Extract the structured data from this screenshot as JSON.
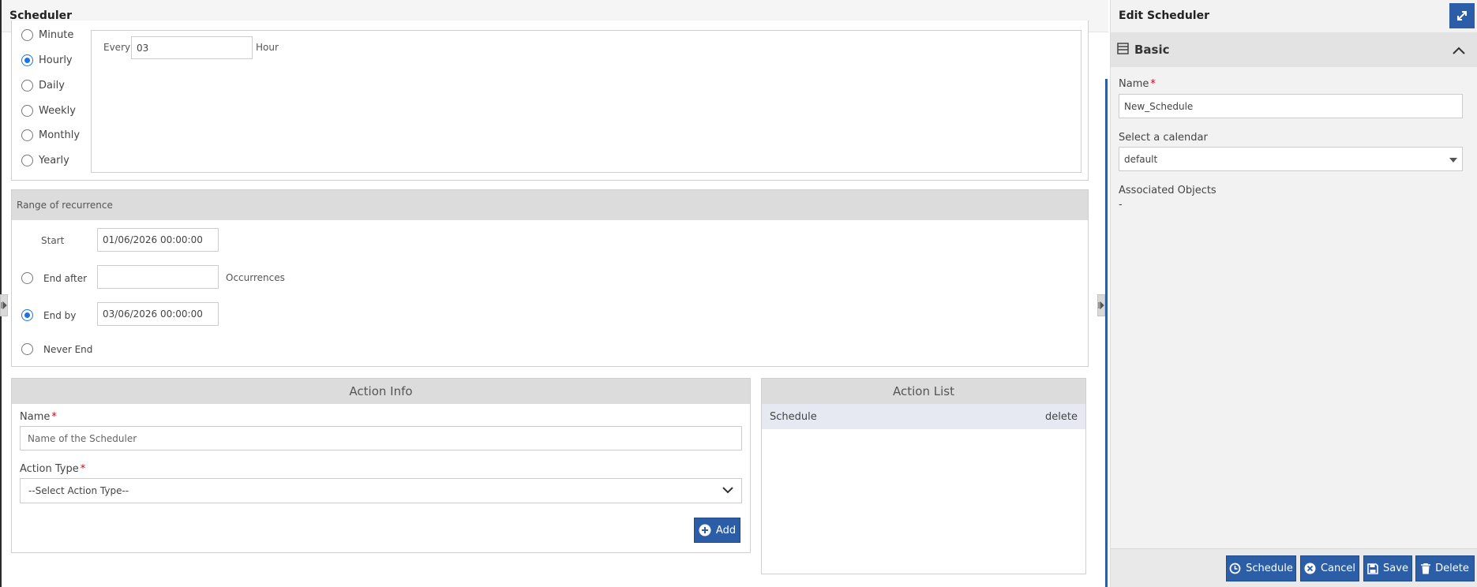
{
  "main": {
    "title": "Scheduler",
    "recurrence": {
      "options": [
        {
          "label": "Minute",
          "checked": false
        },
        {
          "label": "Hourly",
          "checked": true
        },
        {
          "label": "Daily",
          "checked": false
        },
        {
          "label": "Weekly",
          "checked": false
        },
        {
          "label": "Monthly",
          "checked": false
        },
        {
          "label": "Yearly",
          "checked": false
        }
      ],
      "every_label": "Every",
      "every_value": "03",
      "unit_label": "Hour"
    },
    "range": {
      "header": "Range of recurrence",
      "start_label": "Start",
      "start_value": "01/06/2026 00:00:00",
      "end_after_label": "End after",
      "end_after_value": "",
      "occurrences_label": "Occurrences",
      "end_by_label": "End by",
      "end_by_value": "03/06/2026 00:00:00",
      "never_end_label": "Never End",
      "selected": "end_by"
    },
    "action_info": {
      "header": "Action Info",
      "name_label": "Name",
      "name_placeholder": "Name of the Scheduler",
      "action_type_label": "Action Type",
      "action_type_value": "--Select Action Type--",
      "add_label": "Add"
    },
    "action_list": {
      "header": "Action List",
      "rows": [
        {
          "name": "Schedule",
          "action": "delete"
        }
      ]
    }
  },
  "side": {
    "title": "Edit Scheduler",
    "basic_label": "Basic",
    "name_label": "Name",
    "name_value": "New_Schedule",
    "calendar_label": "Select a calendar",
    "calendar_value": "default",
    "associated_label": "Associated Objects",
    "associated_value": "-",
    "buttons": {
      "schedule": "Schedule",
      "cancel": "Cancel",
      "save": "Save",
      "delete": "Delete"
    }
  },
  "colors": {
    "primary": "#2b5ea7",
    "radio_active": "#1a73e8",
    "required": "#d0021b",
    "section_header": "#dcdcdc"
  }
}
